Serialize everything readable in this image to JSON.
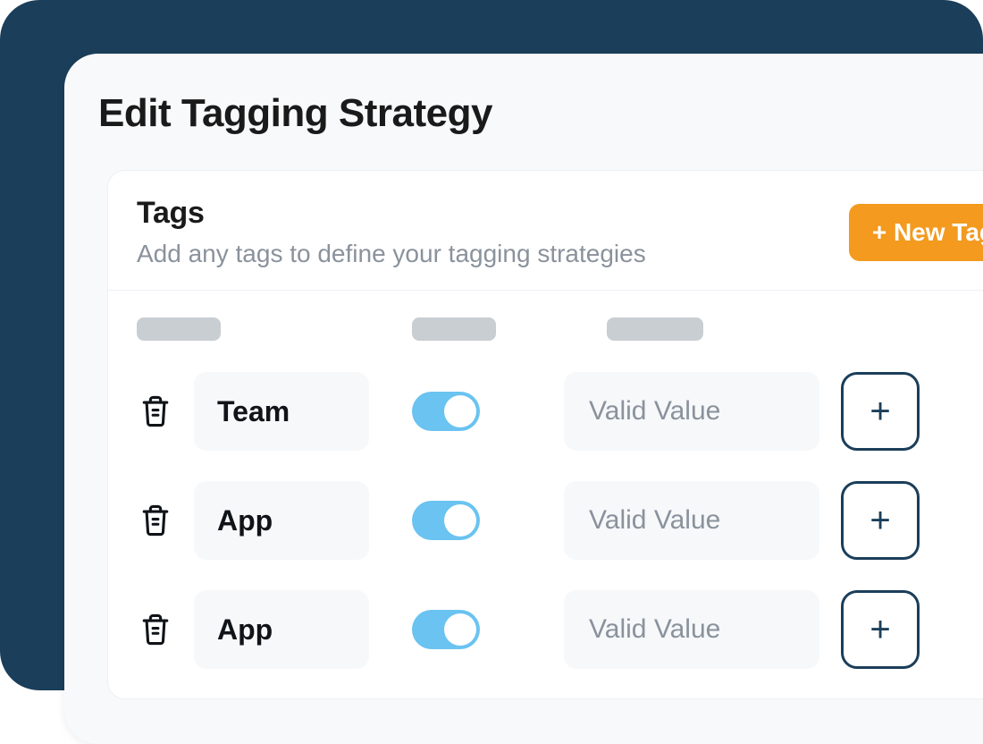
{
  "page": {
    "title": "Edit Tagging Strategy"
  },
  "tagsSection": {
    "title": "Tags",
    "subtitle": "Add any tags to define your tagging strategies",
    "newTagLabel": "+ New Tag"
  },
  "rows": [
    {
      "name": "Team",
      "enabled": true,
      "valuePlaceholder": "Valid Value",
      "plusLabel": "+"
    },
    {
      "name": "App",
      "enabled": true,
      "valuePlaceholder": "Valid Value",
      "plusLabel": "+"
    },
    {
      "name": "App",
      "enabled": true,
      "valuePlaceholder": "Valid Value",
      "plusLabel": "+"
    }
  ]
}
